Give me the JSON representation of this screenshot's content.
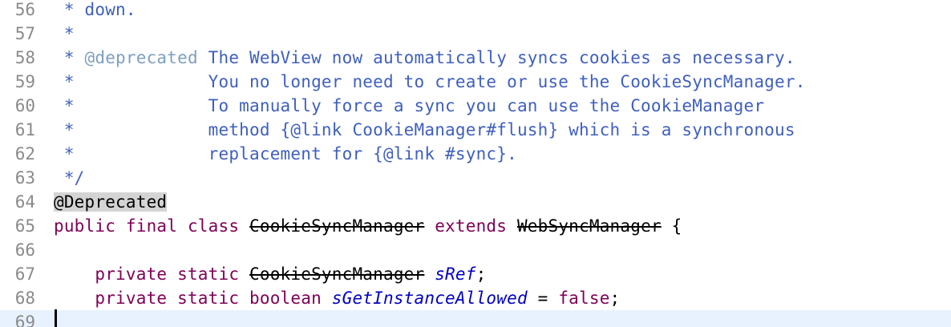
{
  "editor": {
    "lines": [
      {
        "number": "56",
        "segments": [
          {
            "type": "doc",
            "text": " * down."
          }
        ]
      },
      {
        "number": "57",
        "segments": [
          {
            "type": "doc",
            "text": " *"
          }
        ]
      },
      {
        "number": "58",
        "segments": [
          {
            "type": "doc",
            "text": " * "
          },
          {
            "type": "doctag",
            "text": "@deprecated"
          },
          {
            "type": "doc",
            "text": " The WebView now automatically syncs cookies as necessary."
          }
        ]
      },
      {
        "number": "59",
        "segments": [
          {
            "type": "doc",
            "text": " *             You no longer need to create or use the CookieSyncManager."
          }
        ]
      },
      {
        "number": "60",
        "segments": [
          {
            "type": "doc",
            "text": " *             To manually force a sync you can use the CookieManager"
          }
        ]
      },
      {
        "number": "61",
        "segments": [
          {
            "type": "doc",
            "text": " *             method {@link CookieManager#flush} which is a synchronous"
          }
        ]
      },
      {
        "number": "62",
        "segments": [
          {
            "type": "doc",
            "text": " *             replacement for {@link #sync}."
          }
        ]
      },
      {
        "number": "63",
        "segments": [
          {
            "type": "doc",
            "text": " */"
          }
        ]
      },
      {
        "number": "64",
        "segments": [
          {
            "type": "ann-hl",
            "text": "@Deprecated"
          }
        ]
      },
      {
        "number": "65",
        "segments": [
          {
            "type": "kw",
            "text": "public final class "
          },
          {
            "type": "deprecated",
            "text": "CookieSyncManager"
          },
          {
            "type": "kw",
            "text": " extends "
          },
          {
            "type": "deprecated",
            "text": "WebSyncManager"
          },
          {
            "type": "plain",
            "text": " {"
          }
        ]
      },
      {
        "number": "66",
        "segments": []
      },
      {
        "number": "67",
        "segments": [
          {
            "type": "plain",
            "text": "    "
          },
          {
            "type": "kw",
            "text": "private static "
          },
          {
            "type": "deprecated",
            "text": "CookieSyncManager"
          },
          {
            "type": "plain",
            "text": " "
          },
          {
            "type": "field",
            "text": "sRef"
          },
          {
            "type": "plain",
            "text": ";"
          }
        ]
      },
      {
        "number": "68",
        "segments": [
          {
            "type": "plain",
            "text": "    "
          },
          {
            "type": "kw",
            "text": "private static boolean "
          },
          {
            "type": "field",
            "text": "sGetInstanceAllowed"
          },
          {
            "type": "plain",
            "text": " = "
          },
          {
            "type": "kw",
            "text": "false"
          },
          {
            "type": "plain",
            "text": ";"
          }
        ]
      },
      {
        "number": "69",
        "segments": [],
        "current": true
      }
    ],
    "colors": {
      "javadoc": "#3f5fbf",
      "javadoc_tag": "#7f9fbf",
      "keyword": "#7f0055",
      "annotation": "#646464",
      "field": "#0000c0",
      "line_number": "#8a8a8a",
      "current_line": "#e8f2fe"
    }
  }
}
